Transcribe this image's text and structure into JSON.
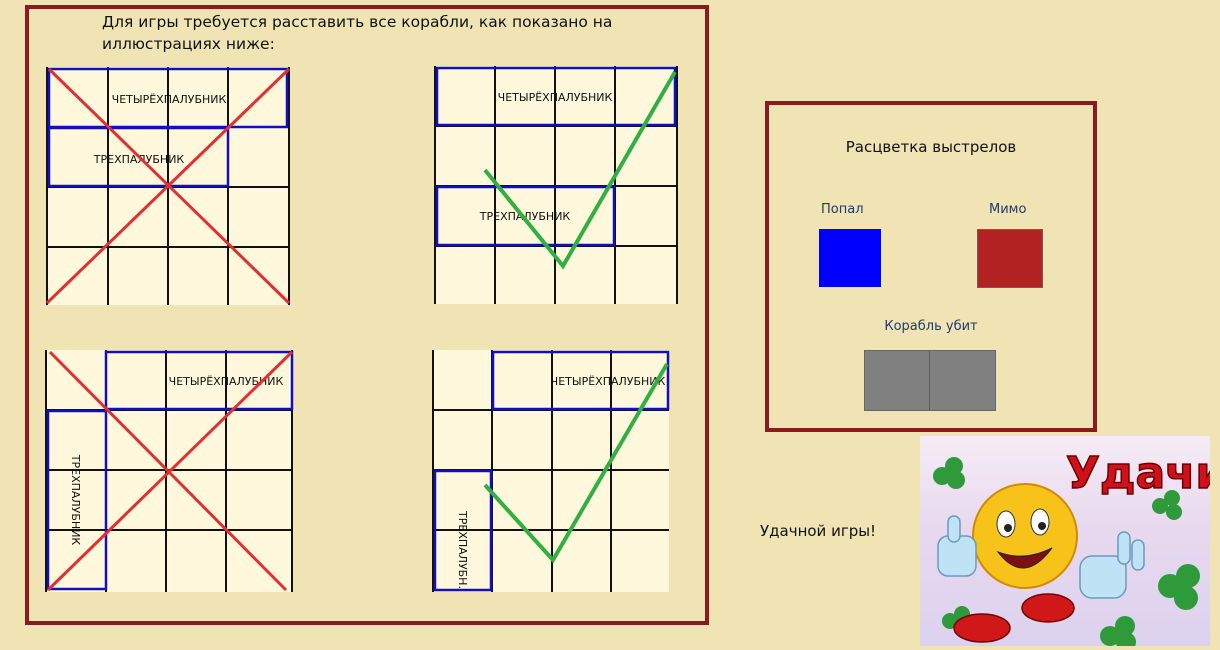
{
  "intro_text": "Для игры требуется расставить все корабли, как показано на иллюстрациях ниже:",
  "grids": {
    "top_left": {
      "four_deck": "ЧЕТЫРЁХПАЛУБНИК",
      "three_deck": "ТРЕХПАЛУБНИК",
      "verdict": "wrong"
    },
    "top_right": {
      "four_deck": "ЧЕТЫРЁХПАЛУБНИК",
      "three_deck": "ТРЕХПАЛУБНИК",
      "verdict": "correct"
    },
    "bottom_left": {
      "four_deck": "ЧЕТЫРЁХПАЛУБНИК",
      "three_deck": "ТРЕХПАЛУБНИК",
      "verdict": "wrong"
    },
    "bottom_right": {
      "four_deck": "ЧЕТЫРЁХПАЛУБНИК",
      "three_deck": "ТРЕХПАЛУБН.",
      "verdict": "correct"
    }
  },
  "legend": {
    "title": "Расцветка выстрелов",
    "hit_label": "Попал",
    "miss_label": "Мимо",
    "sunk_label": "Корабль убит",
    "colors": {
      "hit": "#0000ff",
      "miss": "#b22222",
      "sunk": "#808080"
    }
  },
  "good_luck_text": "Удачной игры!",
  "banner": {
    "text": "Удачи",
    "text_color": "#d0101a"
  },
  "colors": {
    "background": "#f0e4b4",
    "frame": "#8b1a1f",
    "grid_fill": "#fff8dc",
    "ship_outline": "#1010c0",
    "cross": "#e03030",
    "check": "#30b040"
  }
}
